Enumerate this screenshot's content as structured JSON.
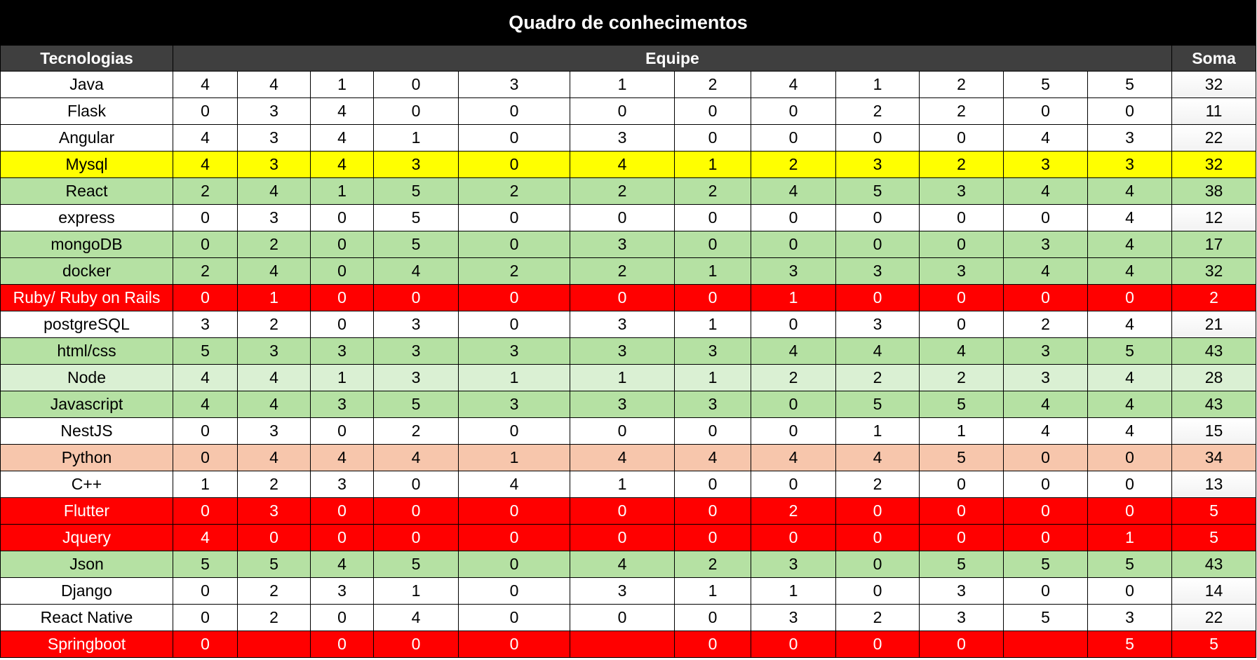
{
  "title": "Quadro de conhecimentos",
  "headers": {
    "tech": "Tecnologias",
    "team": "Equipe",
    "sum": "Soma"
  },
  "colors": {
    "title_bg": "#000000",
    "header_bg": "#3f3f3f",
    "yellow": "#ffff00",
    "green": "#b5e1a3",
    "light_green": "#daf0d3",
    "salmon": "#f7c6ac",
    "red": "#ff0000",
    "white": "#ffffff"
  },
  "rows": [
    {
      "name": "Java",
      "values": [
        "4",
        "4",
        "1",
        "0",
        "3",
        "1",
        "2",
        "4",
        "1",
        "2",
        "5",
        "5"
      ],
      "sum": "32",
      "color": "white"
    },
    {
      "name": "Flask",
      "values": [
        "0",
        "3",
        "4",
        "0",
        "0",
        "0",
        "0",
        "0",
        "2",
        "2",
        "0",
        "0"
      ],
      "sum": "11",
      "color": "white"
    },
    {
      "name": "Angular",
      "values": [
        "4",
        "3",
        "4",
        "1",
        "0",
        "3",
        "0",
        "0",
        "0",
        "0",
        "4",
        "3"
      ],
      "sum": "22",
      "color": "white"
    },
    {
      "name": "Mysql",
      "values": [
        "4",
        "3",
        "4",
        "3",
        "0",
        "4",
        "1",
        "2",
        "3",
        "2",
        "3",
        "3"
      ],
      "sum": "32",
      "color": "yellow"
    },
    {
      "name": "React",
      "values": [
        "2",
        "4",
        "1",
        "5",
        "2",
        "2",
        "2",
        "4",
        "5",
        "3",
        "4",
        "4"
      ],
      "sum": "38",
      "color": "green"
    },
    {
      "name": "express",
      "values": [
        "0",
        "3",
        "0",
        "5",
        "0",
        "0",
        "0",
        "0",
        "0",
        "0",
        "0",
        "4"
      ],
      "sum": "12",
      "color": "white"
    },
    {
      "name": "mongoDB",
      "values": [
        "0",
        "2",
        "0",
        "5",
        "0",
        "3",
        "0",
        "0",
        "0",
        "0",
        "3",
        "4"
      ],
      "sum": "17",
      "color": "green"
    },
    {
      "name": "docker",
      "values": [
        "2",
        "4",
        "0",
        "4",
        "2",
        "2",
        "1",
        "3",
        "3",
        "3",
        "4",
        "4"
      ],
      "sum": "32",
      "color": "green"
    },
    {
      "name": "Ruby/ Ruby on Rails",
      "values": [
        "0",
        "1",
        "0",
        "0",
        "0",
        "0",
        "0",
        "1",
        "0",
        "0",
        "0",
        "0"
      ],
      "sum": "2",
      "color": "red"
    },
    {
      "name": "postgreSQL",
      "values": [
        "3",
        "2",
        "0",
        "3",
        "0",
        "3",
        "1",
        "0",
        "3",
        "0",
        "2",
        "4"
      ],
      "sum": "21",
      "color": "white"
    },
    {
      "name": "html/css",
      "values": [
        "5",
        "3",
        "3",
        "3",
        "3",
        "3",
        "3",
        "4",
        "4",
        "4",
        "3",
        "5"
      ],
      "sum": "43",
      "color": "green"
    },
    {
      "name": "Node",
      "values": [
        "4",
        "4",
        "1",
        "3",
        "1",
        "1",
        "1",
        "2",
        "2",
        "2",
        "3",
        "4"
      ],
      "sum": "28",
      "color": "lightgreen"
    },
    {
      "name": "Javascript",
      "values": [
        "4",
        "4",
        "3",
        "5",
        "3",
        "3",
        "3",
        "0",
        "5",
        "5",
        "4",
        "4"
      ],
      "sum": "43",
      "color": "green"
    },
    {
      "name": "NestJS",
      "values": [
        "0",
        "3",
        "0",
        "2",
        "0",
        "0",
        "0",
        "0",
        "1",
        "1",
        "4",
        "4"
      ],
      "sum": "15",
      "color": "white"
    },
    {
      "name": "Python",
      "values": [
        "0",
        "4",
        "4",
        "4",
        "1",
        "4",
        "4",
        "4",
        "4",
        "5",
        "0",
        "0"
      ],
      "sum": "34",
      "color": "salmon"
    },
    {
      "name": "C++",
      "values": [
        "1",
        "2",
        "3",
        "0",
        "4",
        "1",
        "0",
        "0",
        "2",
        "0",
        "0",
        "0"
      ],
      "sum": "13",
      "color": "white"
    },
    {
      "name": "Flutter",
      "values": [
        "0",
        "3",
        "0",
        "0",
        "0",
        "0",
        "0",
        "2",
        "0",
        "0",
        "0",
        "0"
      ],
      "sum": "5",
      "color": "red"
    },
    {
      "name": "Jquery",
      "values": [
        "4",
        "0",
        "0",
        "0",
        "0",
        "0",
        "0",
        "0",
        "0",
        "0",
        "0",
        "1"
      ],
      "sum": "5",
      "color": "red"
    },
    {
      "name": "Json",
      "values": [
        "5",
        "5",
        "4",
        "5",
        "0",
        "4",
        "2",
        "3",
        "0",
        "5",
        "5",
        "5"
      ],
      "sum": "43",
      "color": "green"
    },
    {
      "name": "Django",
      "values": [
        "0",
        "2",
        "3",
        "1",
        "0",
        "3",
        "1",
        "1",
        "0",
        "3",
        "0",
        "0"
      ],
      "sum": "14",
      "color": "white"
    },
    {
      "name": "React Native",
      "values": [
        "0",
        "2",
        "0",
        "4",
        "0",
        "0",
        "0",
        "3",
        "2",
        "3",
        "5",
        "3"
      ],
      "sum": "22",
      "color": "white"
    },
    {
      "name": "Springboot",
      "values": [
        "0",
        "",
        "0",
        "0",
        "0",
        "",
        "0",
        "0",
        "0",
        "0",
        "",
        "5"
      ],
      "sum": "5",
      "color": "red"
    }
  ]
}
